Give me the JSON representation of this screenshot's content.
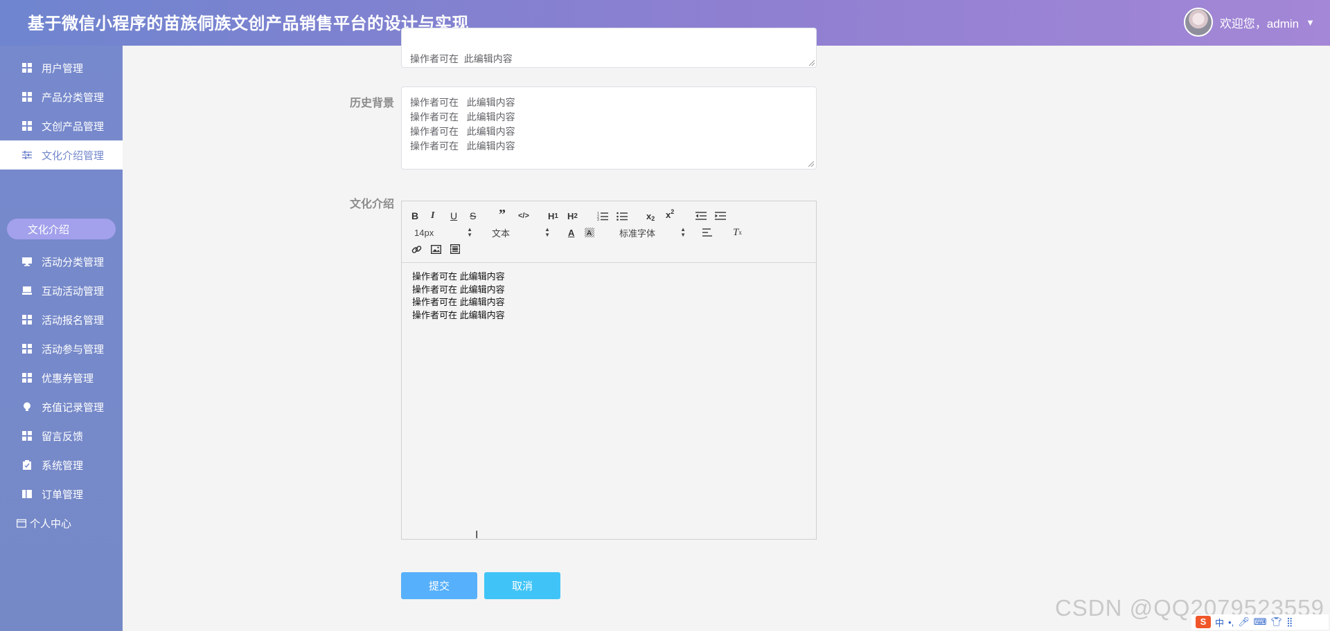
{
  "header": {
    "title": "基于微信小程序的苗族侗族文创产品销售平台的设计与实现",
    "welcome": "欢迎您，admin",
    "caret": "▼"
  },
  "sidebar": {
    "items": [
      {
        "label": "用户管理",
        "icon": "grid-icon"
      },
      {
        "label": "产品分类管理",
        "icon": "grid-icon"
      },
      {
        "label": "文创产品管理",
        "icon": "grid-icon"
      },
      {
        "label": "文化介绍管理",
        "icon": "sliders-icon",
        "active": true
      },
      {
        "label": "活动分类管理",
        "icon": "monitor-icon"
      },
      {
        "label": "互动活动管理",
        "icon": "desktop-icon"
      },
      {
        "label": "活动报名管理",
        "icon": "grid-icon"
      },
      {
        "label": "活动参与管理",
        "icon": "grid-icon"
      },
      {
        "label": "优惠券管理",
        "icon": "grid-icon"
      },
      {
        "label": "充值记录管理",
        "icon": "bulb-icon"
      },
      {
        "label": "留言反馈",
        "icon": "grid-icon"
      },
      {
        "label": "系统管理",
        "icon": "clipboard-icon"
      },
      {
        "label": "订单管理",
        "icon": "book-icon"
      },
      {
        "label": "个人中心",
        "icon": "card-icon"
      }
    ],
    "subitem": "文化介绍"
  },
  "form": {
    "top_textarea_partial": "操作者可在  此编辑内容",
    "history_label": "历史背景",
    "history_value": "操作者可在   此编辑内容\n操作者可在   此编辑内容\n操作者可在   此编辑内容\n操作者可在   此编辑内容",
    "culture_label": "文化介绍",
    "editor": {
      "font_size": "14px",
      "text_type": "文本",
      "font_family": "标准字体",
      "content": [
        "操作者可在 此编辑内容",
        "操作者可在 此编辑内容",
        "操作者可在 此编辑内容",
        "操作者可在 此编辑内容"
      ]
    },
    "submit": "提交",
    "cancel": "取消"
  },
  "watermark": "CSDN @QQ2079523559",
  "ime": {
    "lang": "中"
  },
  "colors": {
    "primary": "#57b0fb",
    "cancel": "#40c4f8",
    "header_start": "#6f85cf",
    "header_end": "#a487d6",
    "sidebar": "#7689cb",
    "active_text": "#7387cc"
  }
}
